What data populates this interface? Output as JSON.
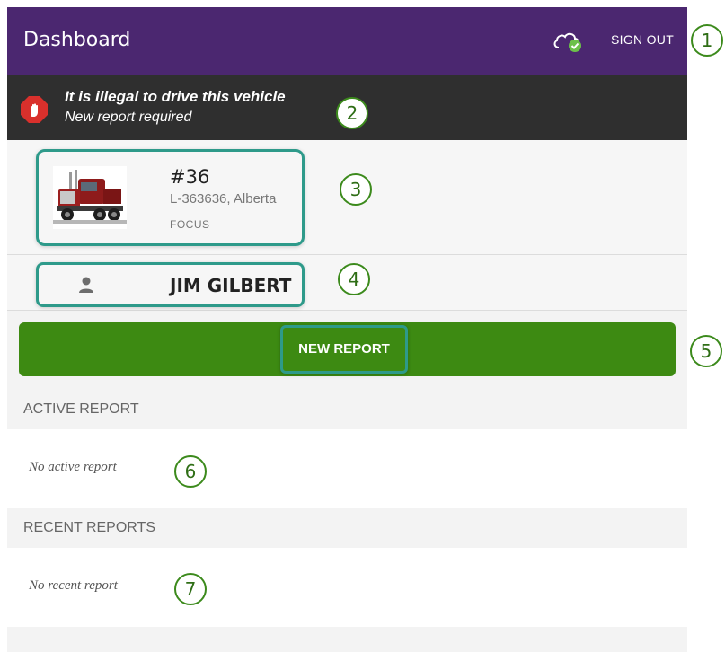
{
  "header": {
    "title": "Dashboard",
    "sync_icon": "cloud-check-icon",
    "sign_out_label": "SIGN OUT"
  },
  "warning": {
    "icon": "stop-hand-icon",
    "line1": "It is illegal to drive this vehicle",
    "line2": "New report required"
  },
  "vehicle": {
    "image": "truck-image",
    "number": "#36",
    "plate": "L-363636, Alberta",
    "model": "FOCUS"
  },
  "driver": {
    "icon": "person-icon",
    "name": "JIM GILBERT"
  },
  "actions": {
    "new_report_label": "NEW REPORT"
  },
  "active_report": {
    "heading": "ACTIVE REPORT",
    "empty_text": "No active report"
  },
  "recent_reports": {
    "heading": "RECENT REPORTS",
    "empty_text": "No recent report"
  },
  "callouts": [
    "1",
    "2",
    "3",
    "4",
    "5",
    "6",
    "7"
  ],
  "colors": {
    "header_bg": "#4b2770",
    "warning_bg": "#2f2f2f",
    "stop_red": "#d9302c",
    "button_green": "#3d8a12",
    "highlight_teal": "#2e9a8a",
    "callout_green": "#3c8a1c"
  }
}
